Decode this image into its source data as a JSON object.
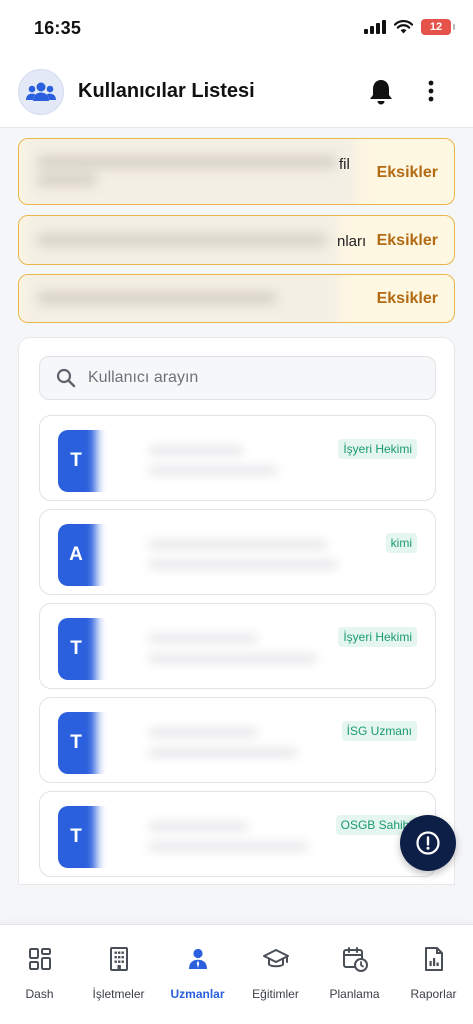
{
  "status_bar": {
    "time": "16:35",
    "battery": "12"
  },
  "header": {
    "title": "Kullanıcılar Listesi"
  },
  "warnings": [
    {
      "visible_fragment": "fil",
      "action_label": "Eksikler"
    },
    {
      "visible_fragment": "nları",
      "action_label": "Eksikler"
    },
    {
      "visible_fragment": "",
      "action_label": "Eksikler"
    }
  ],
  "search": {
    "placeholder": "Kullanıcı arayın",
    "value": ""
  },
  "users": [
    {
      "initial": "T",
      "role": "İşyeri Hekimi"
    },
    {
      "initial": "A",
      "role": "kimi"
    },
    {
      "initial": "T",
      "role": "İşyeri Hekimi"
    },
    {
      "initial": "T",
      "role": "İSG Uzmanı"
    },
    {
      "initial": "T",
      "role": "OSGB Sahibi"
    }
  ],
  "nav": [
    {
      "label": "Dash",
      "icon": "dashboard-icon",
      "active": false
    },
    {
      "label": "İşletmeler",
      "icon": "building-icon",
      "active": false
    },
    {
      "label": "Uzmanlar",
      "icon": "person-icon",
      "active": true
    },
    {
      "label": "Eğitimler",
      "icon": "graduation-cap-icon",
      "active": false
    },
    {
      "label": "Planlama",
      "icon": "calendar-clock-icon",
      "active": false
    },
    {
      "label": "Raporlar",
      "icon": "report-icon",
      "active": false
    }
  ],
  "colors": {
    "primary": "#2a5fdd",
    "warning_border": "#eab64a",
    "warning_bg": "#fef7e2",
    "warning_text": "#b26b12",
    "badge_bg": "#e4f6ef",
    "badge_text": "#1b9a70",
    "fab_bg": "#0d1e47",
    "battery_low": "#e5534b"
  }
}
